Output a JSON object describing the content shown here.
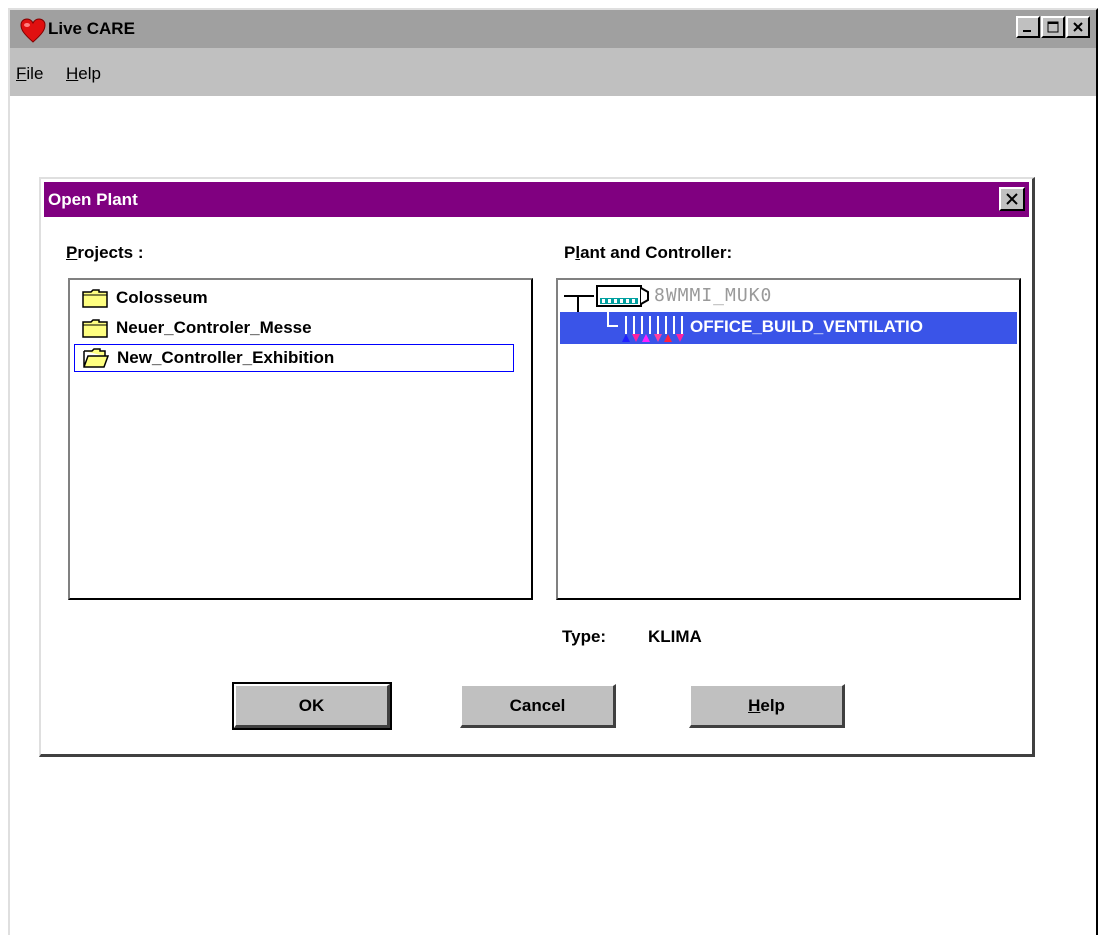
{
  "app": {
    "title": "Live CARE",
    "menu": [
      {
        "label": "File",
        "accel": "F",
        "rest": "ile"
      },
      {
        "label": "Help",
        "accel": "H",
        "rest": "elp"
      }
    ]
  },
  "dialog": {
    "title": "Open Plant",
    "projects_label_accel": "P",
    "projects_label_rest": "rojects :",
    "plant_label_pre": "P",
    "plant_label_accel": "l",
    "plant_label_rest": "ant and Controller:",
    "projects": [
      {
        "name": "Colosseum",
        "icon": "folder-closed-icon"
      },
      {
        "name": "Neuer_Controler_Messe",
        "icon": "folder-closed-icon"
      },
      {
        "name": "New_Controller_Exhibition",
        "icon": "folder-open-icon",
        "focused": true
      }
    ],
    "tree": {
      "controller": "8WMMI_MUK0",
      "plant": "OFFICE_BUILD_VENTILATIO"
    },
    "type_label": "Type:",
    "type_value": "KLIMA",
    "buttons": {
      "ok": "OK",
      "cancel": "Cancel",
      "help_accel": "H",
      "help_rest": "elp"
    }
  },
  "colors": {
    "dialog_title_bg": "#800080",
    "selection_bg": "#3a54e8",
    "app_title_bg": "#a0a0a0",
    "face": "#c0c0c0"
  }
}
